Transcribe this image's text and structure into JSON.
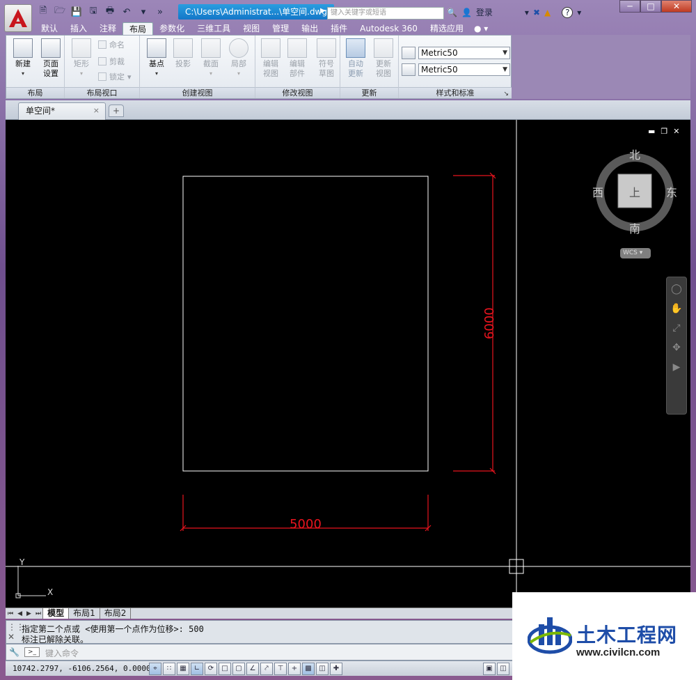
{
  "window": {
    "title_path": "C:\\Users\\Administrat...\\单空间.dwg",
    "search_placeholder": "键入关键字或短语",
    "login_label": "登录"
  },
  "ribbon_tabs": [
    "默认",
    "插入",
    "注释",
    "布局",
    "参数化",
    "三维工具",
    "视图",
    "管理",
    "输出",
    "插件",
    "Autodesk 360",
    "精选应用"
  ],
  "active_tab": "布局",
  "panels": {
    "layout": {
      "title": "布局",
      "new_label": "新建",
      "page_setup_l1": "页面",
      "page_setup_l2": "设置"
    },
    "layout_viewport": {
      "title": "布局视口",
      "rect_label": "矩形",
      "name_label": "命名",
      "clip_label": "剪裁",
      "lock_label": "锁定"
    },
    "create_view": {
      "title": "创建视图",
      "base_label": "基点",
      "projected_label": "投影",
      "section_label": "截面",
      "detail_label": "局部"
    },
    "modify_view": {
      "title": "修改视图",
      "edit_view_l1": "编辑",
      "edit_view_l2": "视图",
      "edit_comp_l1": "编辑",
      "edit_comp_l2": "部件",
      "symbol_l1": "符号",
      "symbol_l2": "草图"
    },
    "update": {
      "title": "更新",
      "auto_l1": "自动",
      "auto_l2": "更新",
      "update_view_l1": "更新",
      "update_view_l2": "视图"
    },
    "styles": {
      "title": "样式和标准",
      "style1": "Metric50",
      "style2": "Metric50"
    }
  },
  "doc_tab": {
    "label": "单空间*",
    "close": "×"
  },
  "canvas": {
    "dim_horizontal": "5000",
    "dim_vertical": "6000",
    "compass": {
      "north": "北",
      "south": "南",
      "east": "东",
      "west": "西",
      "top": "上"
    },
    "wcs_label": "WCS",
    "ucs_x": "X",
    "ucs_y": "Y"
  },
  "layout_tabs": [
    "模型",
    "布局1",
    "布局2"
  ],
  "active_layout_tab": "模型",
  "command": {
    "line1": "指定第二个点或 <使用第一个点作为位移>: 500",
    "line2": "标注已解除关联。",
    "input_placeholder": "键入命令"
  },
  "status": {
    "coords": "10742.2797, -6106.2564, 0.0000"
  },
  "watermark": {
    "title": "土木工程网",
    "url": "www.civilcn.com"
  },
  "colors": {
    "dimension": "#e8141e",
    "accent": "#1477c8",
    "canvas": "#000000"
  }
}
